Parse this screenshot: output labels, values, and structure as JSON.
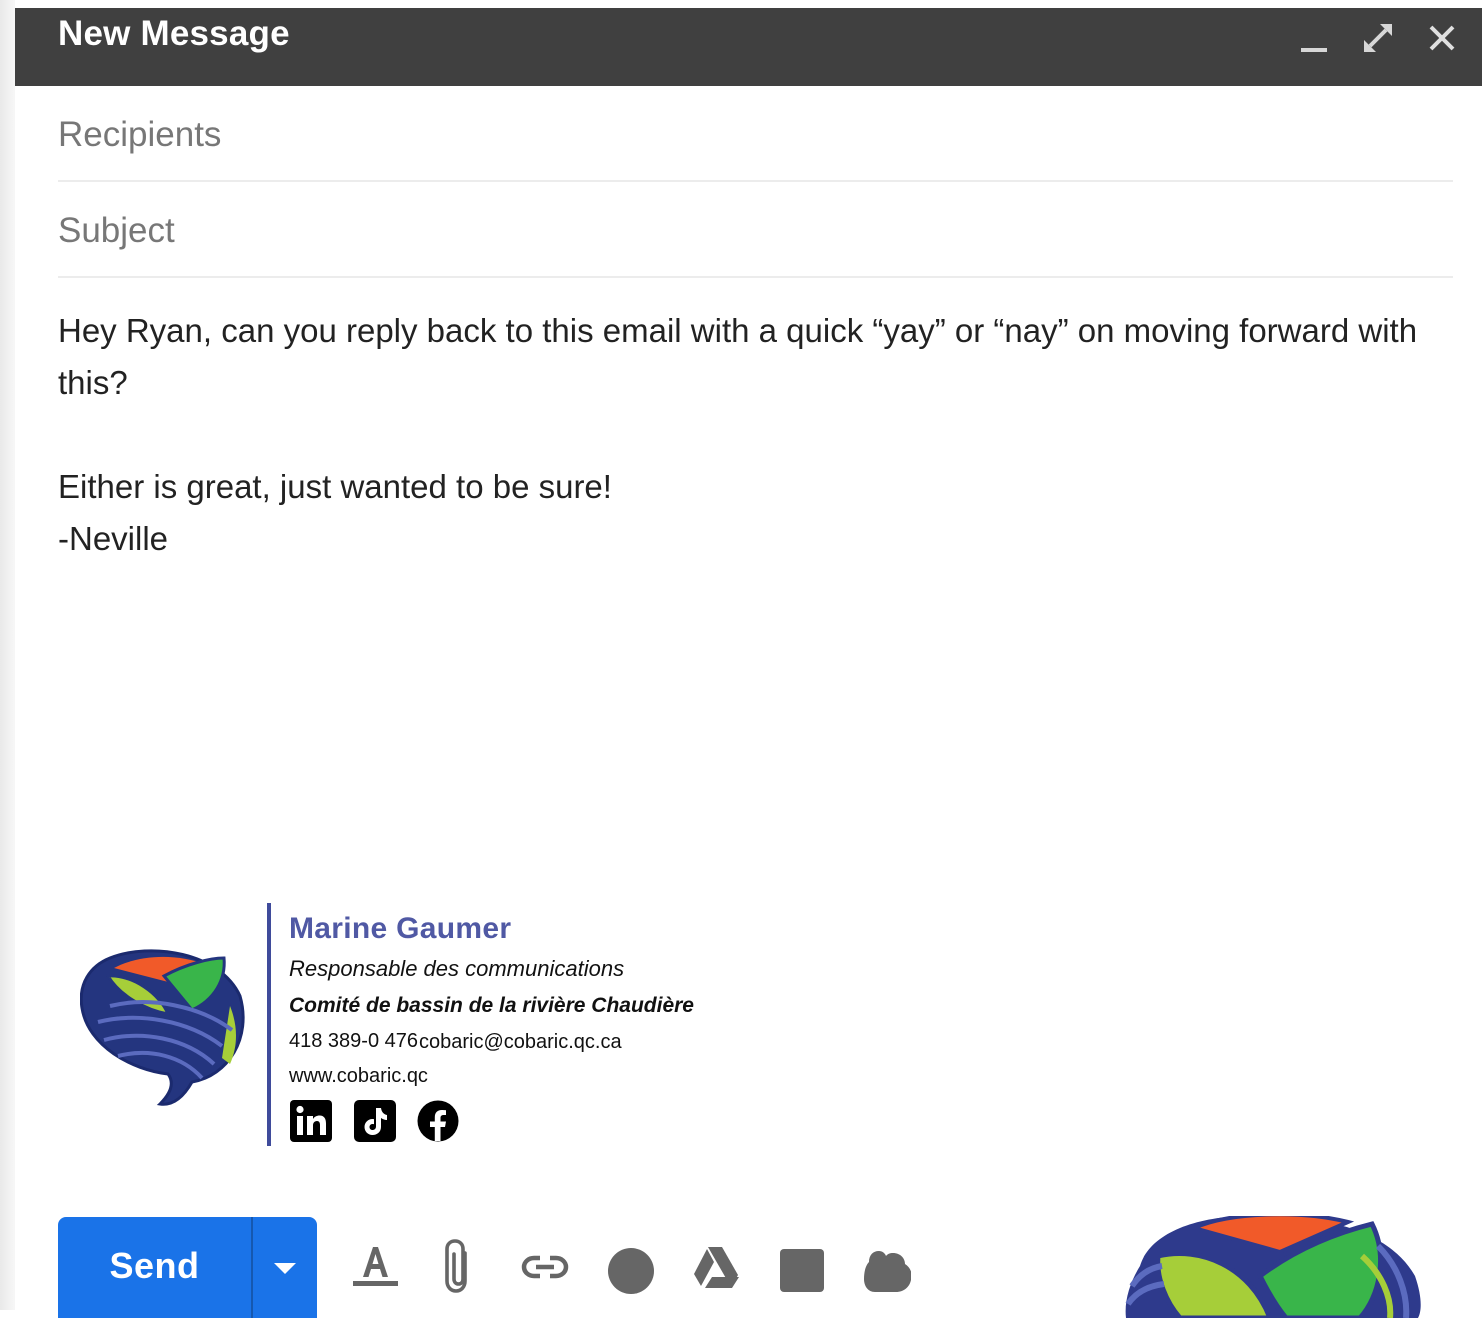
{
  "window": {
    "title": "New Message",
    "controls": [
      {
        "name": "minimize-icon"
      },
      {
        "name": "expand-icon"
      },
      {
        "name": "close-icon"
      }
    ]
  },
  "fields": {
    "recipients_placeholder": "Recipients",
    "recipients_value": "",
    "subject_placeholder": "Subject",
    "subject_value": ""
  },
  "body": {
    "line1": "Hey Ryan, can you reply back to this email with a quick “yay” or “nay” on moving forward with this?",
    "line2": "Either is great, just wanted to be sure!",
    "line3": "-Neville"
  },
  "signature": {
    "name": "Marine Gaumer",
    "role": "Responsable des communications",
    "organization": "Comité de bassin de la rivière Chaudière",
    "phone": "418 389-0 476",
    "email": "cobaric@cobaric.qc.ca",
    "website": "www.cobaric.qc",
    "social": [
      "linkedin-icon",
      "tiktok-icon",
      "facebook-icon"
    ],
    "colors": {
      "name": "#5059a4",
      "accent_bar": "#3f4b9b"
    }
  },
  "toolbar": {
    "send_label": "Send",
    "send_color": "#1a73e8",
    "tools": [
      "text-format-icon",
      "attach-icon",
      "link-icon",
      "emoji-icon",
      "drive-icon",
      "photo-icon",
      "confidential-icon"
    ]
  }
}
